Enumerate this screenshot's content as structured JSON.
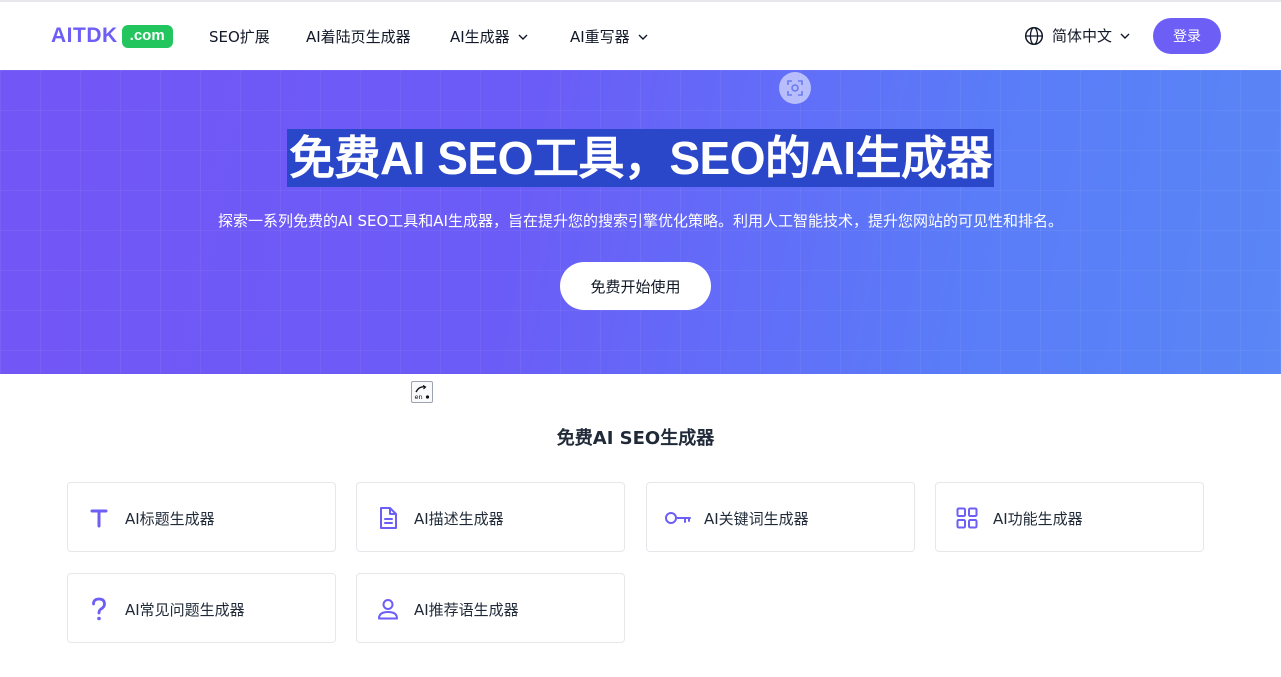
{
  "header": {
    "logo_text": "AITDK",
    "logo_badge": ".com",
    "nav": [
      {
        "label": "SEO扩展"
      },
      {
        "label": "AI着陆页生成器"
      },
      {
        "label": "AI生成器"
      },
      {
        "label": "AI重写器"
      }
    ],
    "language": "简体中文",
    "login_label": "登录"
  },
  "hero": {
    "title": "免费AI SEO工具，SEO的AI生成器",
    "subtitle": "探索一系列免费的AI SEO工具和AI生成器，旨在提升您的搜索引擎优化策略。利用人工智能技术，提升您网站的可见性和排名。",
    "cta_label": "免费开始使用"
  },
  "section": {
    "title": "免费AI SEO生成器",
    "cards": [
      {
        "label": "AI标题生成器",
        "icon": "title-t-icon"
      },
      {
        "label": "AI描述生成器",
        "icon": "document-icon"
      },
      {
        "label": "AI关键词生成器",
        "icon": "key-icon"
      },
      {
        "label": "AI功能生成器",
        "icon": "grid-icon"
      },
      {
        "label": "AI常见问题生成器",
        "icon": "question-icon"
      },
      {
        "label": "AI推荐语生成器",
        "icon": "user-icon"
      }
    ]
  },
  "colors": {
    "brand": "#6d5ef6",
    "badge": "#22c55e",
    "icon": "#6d5ef6"
  }
}
